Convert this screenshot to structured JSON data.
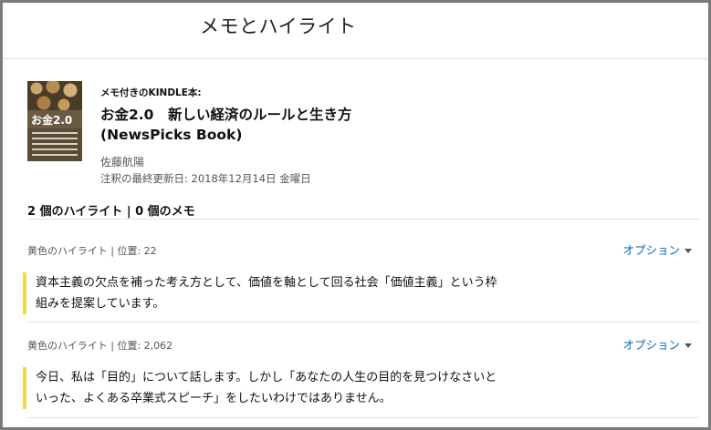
{
  "header": {
    "title": "メモとハイライト"
  },
  "book": {
    "section_label": "メモ付きのKINDLE本:",
    "title_line1": "お金2.0　新しい経済のルールと生き方",
    "title_line2": "(NewsPicks Book)",
    "author": "佐藤航陽",
    "last_updated": "注釈の最終更新日:  2018年12月14日 金曜日",
    "cover": {
      "title": "お金2.0",
      "colors": {
        "bg": "#6b5a43",
        "text": "#ffffff"
      }
    }
  },
  "summary": {
    "counts": "2 個のハイライト |  0 個のメモ"
  },
  "highlights": [
    {
      "meta": "黄色のハイライト | 位置: 22",
      "options_label": "オプション",
      "text_line1": "資本主義の欠点を補った考え方として、価値を軸として回る社会「価値主義」という枠",
      "text_line2": "組みを提案しています。"
    },
    {
      "meta": "黄色のハイライト | 位置: 2,062",
      "options_label": "オプション",
      "text_line1": "今日、私は「目的」について話します。しかし「あなたの人生の目的を見つけなさいと",
      "text_line2": "いった、よくある卒業式スピーチ」をしたいわけではありません。"
    }
  ],
  "colors": {
    "highlight_yellow": "#f3d94a",
    "link_blue": "#0066c0",
    "frame_border": "#7a7a7a"
  }
}
